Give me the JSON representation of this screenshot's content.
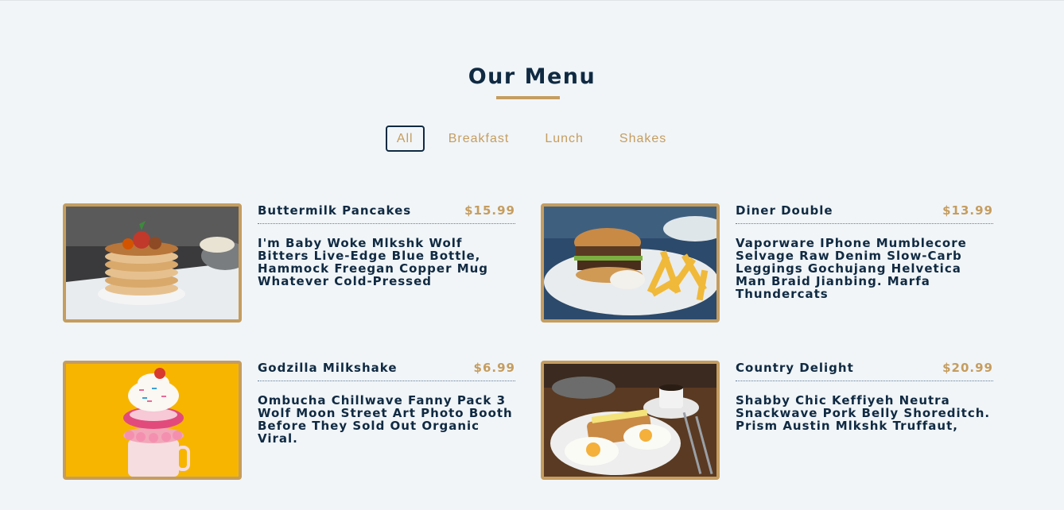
{
  "section": {
    "title": "Our Menu",
    "accent_color": "#c59d5f",
    "text_color": "#102a42"
  },
  "filters": [
    {
      "label": "All",
      "active": true
    },
    {
      "label": "Breakfast",
      "active": false
    },
    {
      "label": "Lunch",
      "active": false
    },
    {
      "label": "Shakes",
      "active": false
    }
  ],
  "items": [
    {
      "name": "Buttermilk Pancakes",
      "price": "$15.99",
      "description": "I'm Baby Woke Mlkshk Wolf Bitters Live-Edge Blue Bottle, Hammock Freegan Copper Mug Whatever Cold-Pressed",
      "photo": "pancakes-photo"
    },
    {
      "name": "Diner Double",
      "price": "$13.99",
      "description": "Vaporware IPhone Mumblecore Selvage Raw Denim Slow-Carb Leggings Gochujang Helvetica Man Braid Jianbing. Marfa Thundercats",
      "photo": "burger-photo"
    },
    {
      "name": "Godzilla Milkshake",
      "price": "$6.99",
      "description": "Ombucha Chillwave Fanny Pack 3 Wolf Moon Street Art Photo Booth Before They Sold Out Organic Viral.",
      "photo": "milkshake-photo"
    },
    {
      "name": "Country Delight",
      "price": "$20.99",
      "description": "Shabby Chic Keffiyeh Neutra Snackwave Pork Belly Shoreditch. Prism Austin Mlkshk Truffaut,",
      "photo": "breakfast-plate-photo"
    }
  ]
}
